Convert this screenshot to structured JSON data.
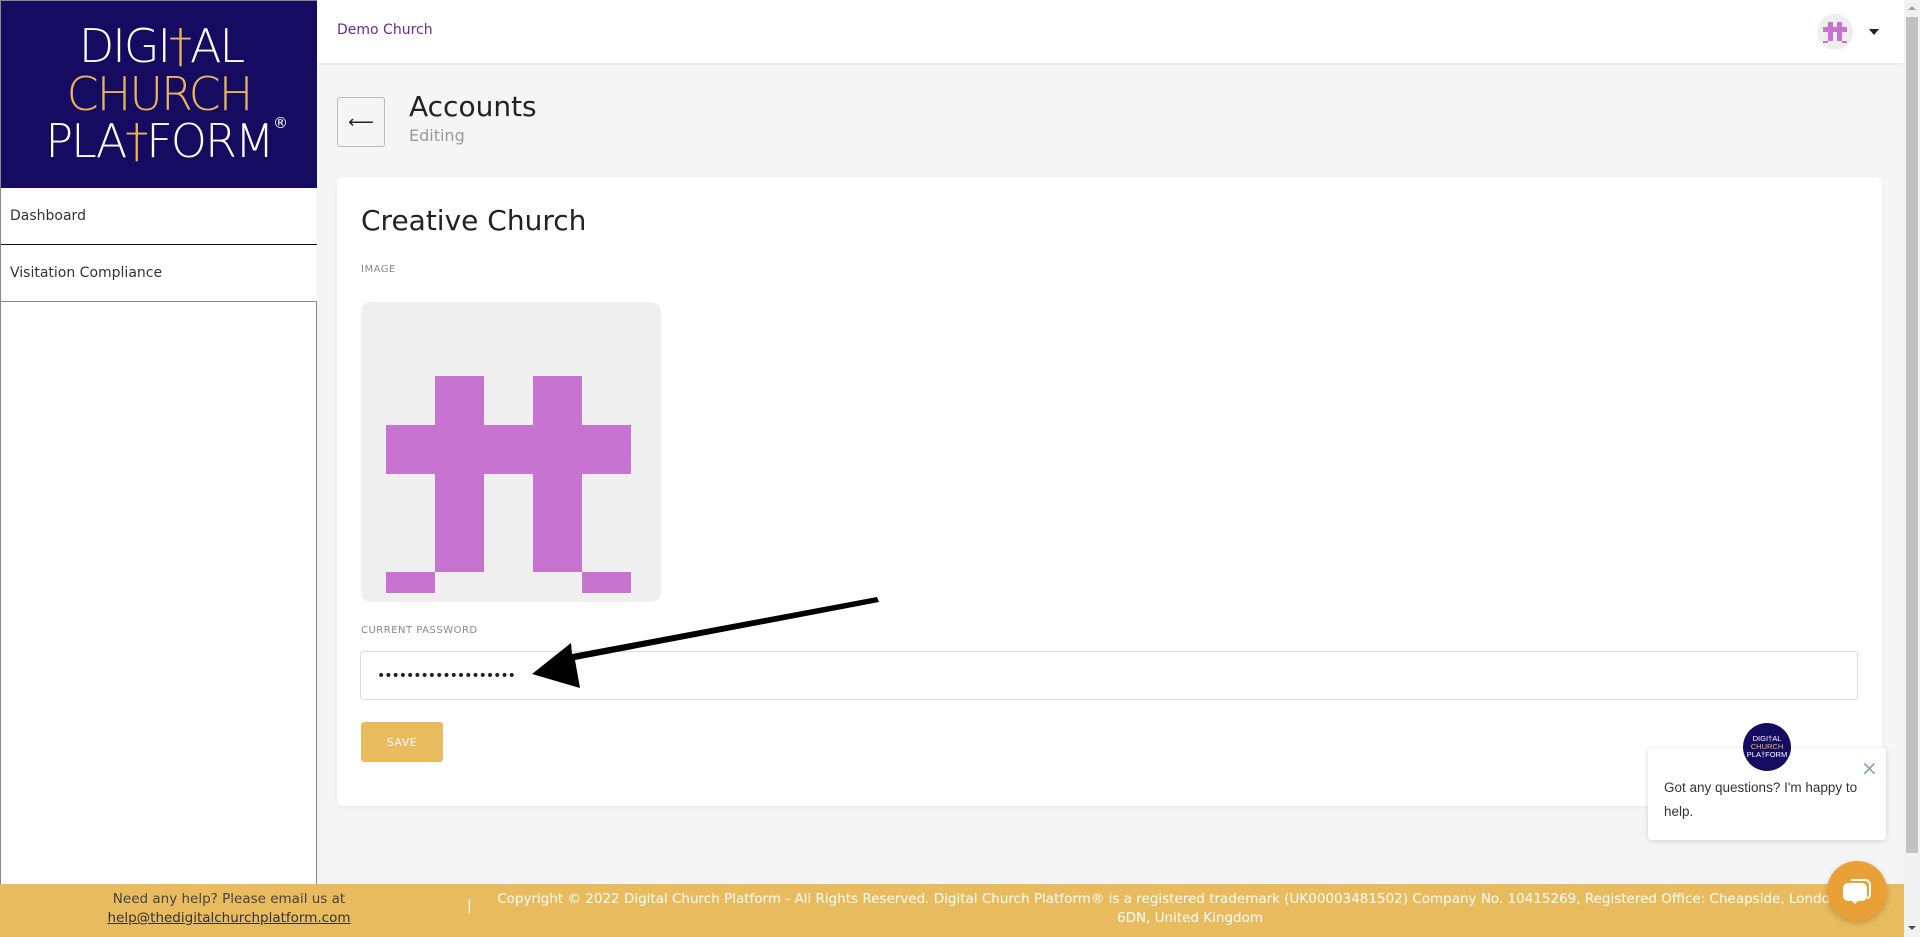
{
  "brand": {
    "logo_line1_a": "DIGI",
    "logo_line1_cross": "†",
    "logo_line1_b": "AL",
    "logo_line2": "CHURCH",
    "logo_line3_a": "PLA",
    "logo_line3_cross": "†",
    "logo_line3_b": "FORM",
    "registered": "®"
  },
  "sidebar": {
    "items": [
      {
        "label": "Dashboard"
      },
      {
        "label": "Visitation Compliance"
      }
    ]
  },
  "header": {
    "breadcrumb": "Demo Church",
    "avatar_icon": "identicon",
    "menu_icon": "caret-down"
  },
  "page": {
    "back_icon": "⟵",
    "title": "Accounts",
    "subtitle": "Editing"
  },
  "form": {
    "account_name": "Creative Church",
    "image_label": "IMAGE",
    "identicon_color": "#c774d1",
    "password_label": "CURRENT PASSWORD",
    "password_value": "•••••••••••••••••••",
    "save_label": "SAVE"
  },
  "chat": {
    "avatar_text": [
      "DIGI†AL",
      "CHURCH",
      "PLA†FORM"
    ],
    "message": "Got any questions? I'm happy to help.",
    "close_icon": "×",
    "launcher_icon": "chat-bubbles"
  },
  "footer": {
    "help_text": "Need any help? Please email us at",
    "help_email": "help@thedigitalchurchplatform.com",
    "separator": "|",
    "copyright": "Copyright © 2022 Digital Church Platform - All Rights Reserved. Digital Church Platform® is a registered trademark (UK00003481502) Company No. 10415269, Registered Office: Cheapside, London, EC2V 6DN, United Kingdom"
  },
  "colors": {
    "brand_navy": "#150b61",
    "brand_gold": "#e9bb5f",
    "breadcrumb_purple": "#6a2b8a",
    "launcher_orange": "#e8a037"
  }
}
